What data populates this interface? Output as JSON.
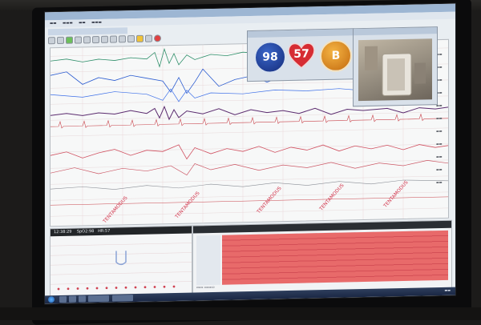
{
  "overlay": {
    "spo2_value": "98",
    "hr_value": "57",
    "grade_value": "B"
  },
  "status_bar": {
    "time": "12:38:29",
    "spo2": "SpO2:98",
    "hr": "HR:57"
  },
  "watermark_text": "TENTAMODUS",
  "colors": {
    "spo2_badge": "#1f3f9e",
    "hr_badge": "#d62c33",
    "grade_badge": "#e58d1f",
    "event_band": "#e05a5f",
    "screen_bg": "#e9eef2"
  },
  "icons": [
    "windows-start-icon",
    "heart-icon",
    "camera-icon"
  ]
}
